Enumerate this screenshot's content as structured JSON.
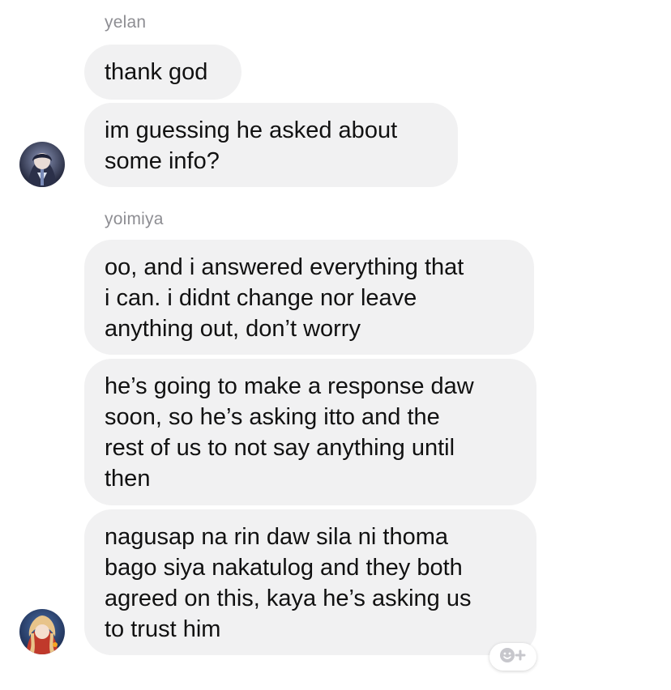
{
  "groups": [
    {
      "sender": "yelan",
      "messages": [
        {
          "lines": [
            "thank god"
          ]
        },
        {
          "lines": [
            "im guessing he asked about",
            "some info?"
          ]
        }
      ]
    },
    {
      "sender": "yoimiya",
      "messages": [
        {
          "lines": [
            "oo, and i answered everything that",
            "i can. i didnt change nor leave",
            "anything out, don’t worry"
          ]
        },
        {
          "lines": [
            "he’s going to make a response daw",
            "soon, so he’s asking itto and the",
            "rest of us to not say anything until",
            "then"
          ]
        },
        {
          "lines": [
            "nagusap na rin daw sila ni thoma",
            "bago siya nakatulog and they both",
            "agreed on this, kaya he’s asking us",
            "to trust him"
          ]
        }
      ]
    }
  ],
  "icons": {
    "avatar_yelan": "avatar-yelan-icon",
    "avatar_yoimiya": "avatar-yoimiya-icon",
    "reaction": "add-reaction-icon"
  },
  "colors": {
    "bubble_bg": "#f1f1f2",
    "sender_name": "#8e8e93",
    "text": "#111111"
  }
}
